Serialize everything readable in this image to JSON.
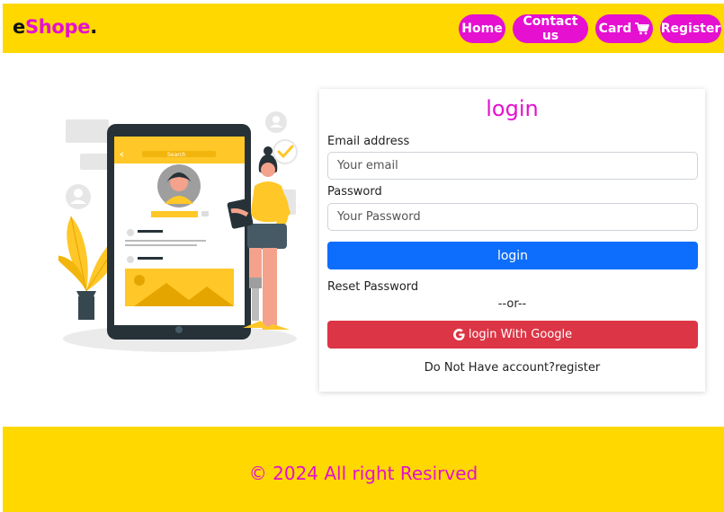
{
  "brand": {
    "part1": "e",
    "part2": "Shope",
    "part3": "."
  },
  "nav": {
    "home": "Home",
    "contact": "Contact us",
    "card": "Card",
    "register": "Register"
  },
  "login_card": {
    "title": "login",
    "email_label": "Email address",
    "email_placeholder": "Your email",
    "password_label": "Password",
    "password_placeholder": "Your Password",
    "login_button": "login",
    "reset_link": "Reset Password",
    "separator": "--or--",
    "google_button": "login With Google",
    "register_prompt": "Do Not Have account?",
    "register_link": "register"
  },
  "illustration": {
    "search_text": "Search"
  },
  "footer": {
    "text": "© 2024 All right Resirved"
  },
  "colors": {
    "accent": "#e510d0",
    "bar": "#ffd800",
    "primary": "#0d6efd",
    "danger": "#dc3545"
  },
  "icons": [
    "cart-icon",
    "google-icon"
  ]
}
